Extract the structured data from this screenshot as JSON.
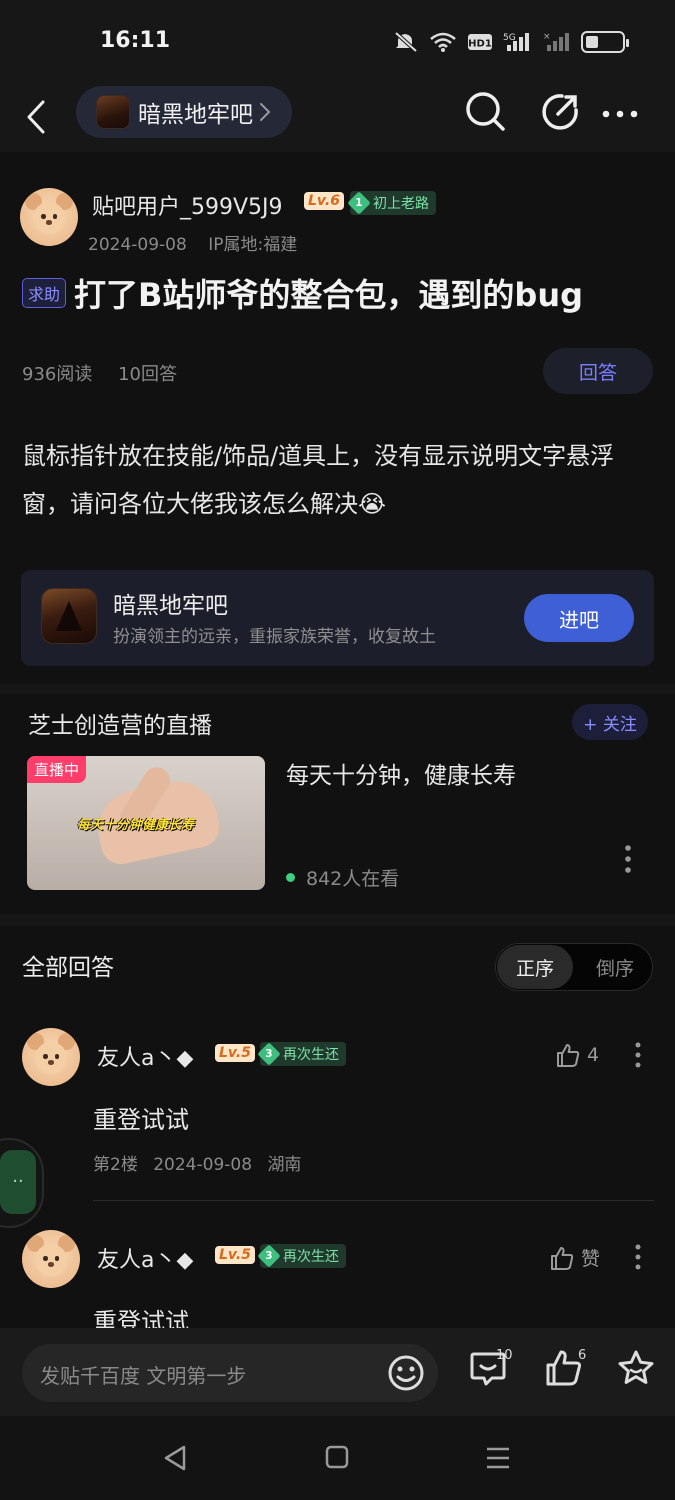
{
  "status_bar": {
    "time": "16:11",
    "network": "5G",
    "hd": "HD1"
  },
  "nav": {
    "forum_name": "暗黑地牢吧"
  },
  "post": {
    "author": "贴吧用户_599V5J9",
    "level": "Lv.6",
    "rank_number": "1",
    "rank_title": "初上老路",
    "date": "2024-09-08",
    "location": "IP属地:福建",
    "tag": "求助",
    "title": "打了B站师爷的整合包，遇到的bug",
    "reads": "936阅读",
    "answers_count": "10回答",
    "answer_button": "回答",
    "body": "鼠标指针放在技能/饰品/道具上，没有显示说明文字悬浮窗，请问各位大佬我该怎么解决😭"
  },
  "forum_card": {
    "name": "暗黑地牢吧",
    "description": "扮演领主的远亲，重振家族荣誉，收复故土",
    "enter_button": "进吧"
  },
  "live": {
    "channel": "芝士创造营的直播",
    "follow_button": "+ 关注",
    "badge": "直播中",
    "thumb_caption": "每天十分钟健康长寿",
    "title": "每天十分钟，健康长寿",
    "viewers": "842人在看"
  },
  "answers": {
    "heading": "全部回答",
    "sort_active": "正序",
    "sort_inactive": "倒序",
    "items": [
      {
        "name": "友人a丶◆",
        "level": "Lv.5",
        "rank_number": "3",
        "rank_title": "再次生还",
        "likes": "4",
        "text": "重登试试",
        "floor": "第2楼",
        "date": "2024-09-08",
        "location": "湖南"
      },
      {
        "name": "友人a丶◆",
        "level": "Lv.5",
        "rank_number": "3",
        "rank_title": "再次生还",
        "likes": "赞",
        "text": "重登试试"
      }
    ]
  },
  "bottom_bar": {
    "compose_placeholder": "发贴千百度 文明第一步",
    "comment_count": "10",
    "like_count": "6"
  },
  "colors": {
    "accent": "#3e5fd6",
    "background": "#111111",
    "live_red": "#ff3d6a",
    "rank_green": "#3fbf7f"
  }
}
